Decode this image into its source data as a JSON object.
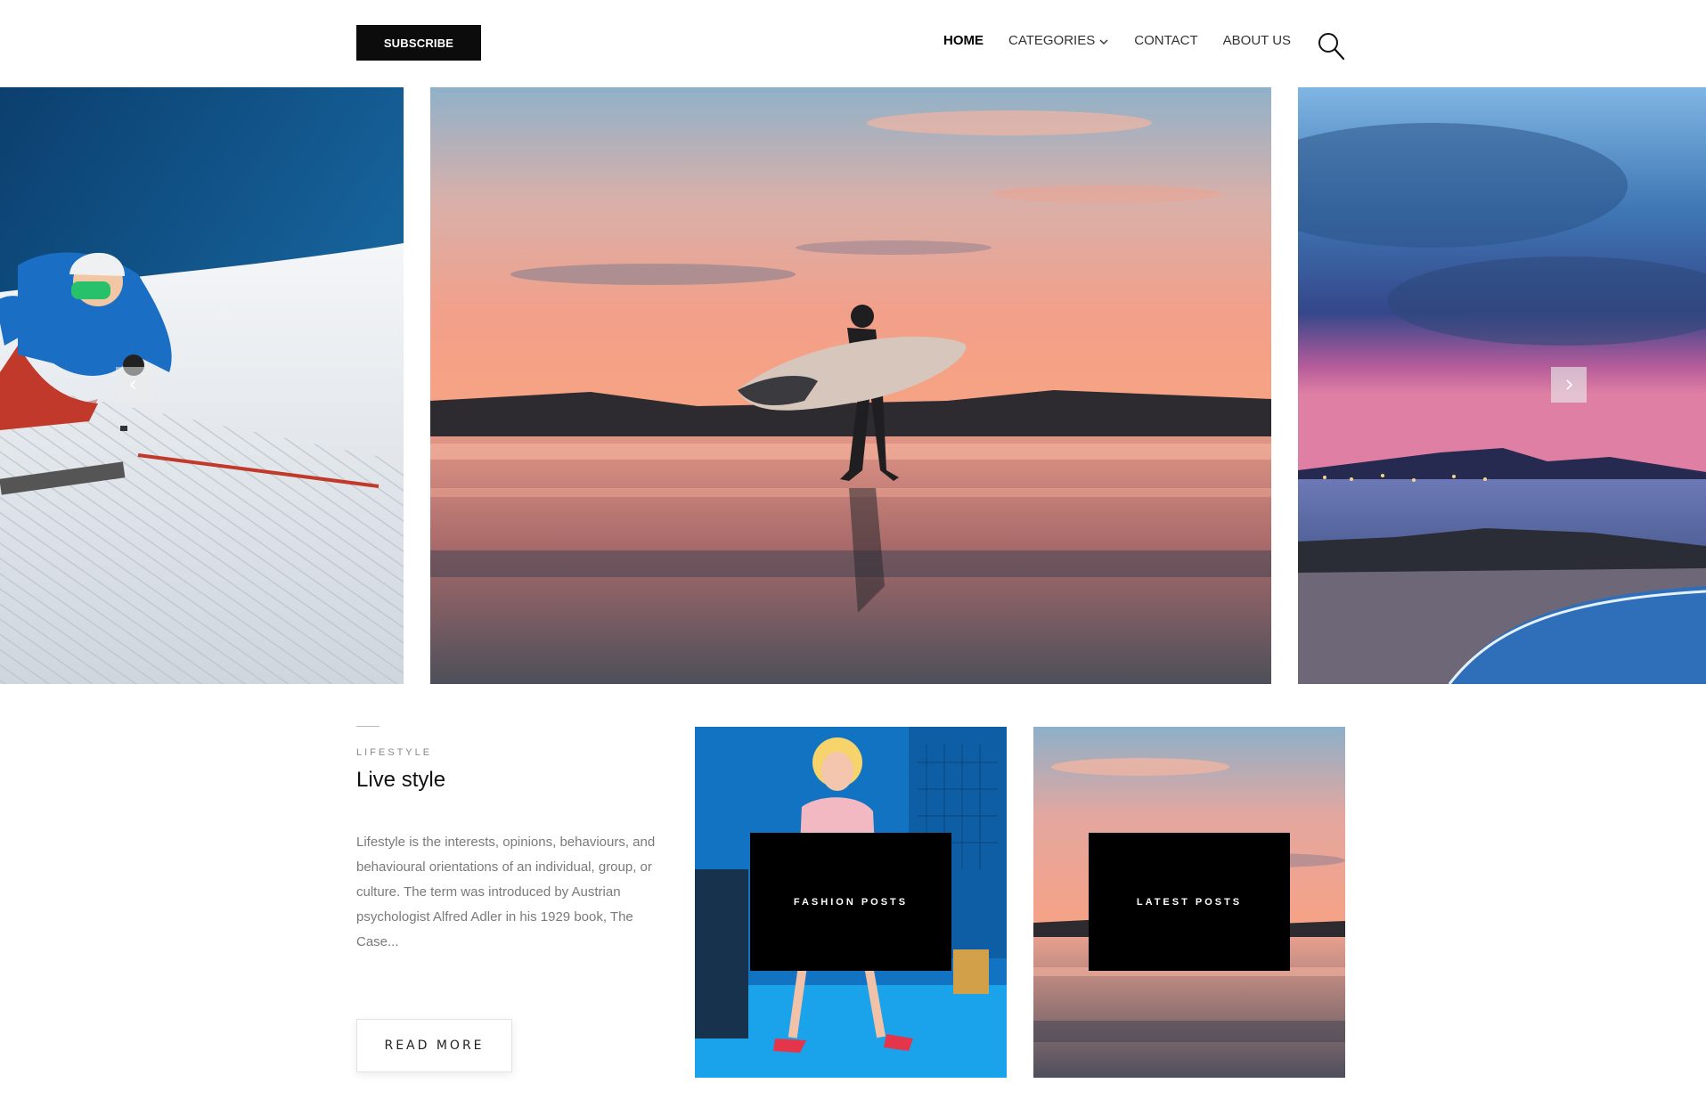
{
  "header": {
    "subscribe_label": "SUBSCRIBE",
    "nav": {
      "home": "HOME",
      "categories": "CATEGORIES",
      "contact": "CONTACT",
      "about": "ABOUT US"
    },
    "search_icon": "search-icon"
  },
  "slider": {
    "slides": [
      {
        "image": "skier-on-snow-slope"
      },
      {
        "image": "surfer-walking-at-sunset"
      },
      {
        "image": "rocky-coast-at-dusk"
      }
    ],
    "prev_icon": "chevron-left-icon",
    "next_icon": "chevron-right-icon"
  },
  "post": {
    "category": "LIFESTYLE",
    "title": "Live style",
    "excerpt": "Lifestyle is the interests, opinions, behaviours, and behavioural orientations of an individual, group, or culture. The term was introduced by Austrian psychologist Alfred Adler in his 1929 book, The Case...",
    "read_more_label": "READ MORE"
  },
  "cards": {
    "fashion": {
      "label": "FASHION POSTS"
    },
    "latest": {
      "label": "LATEST POSTS"
    }
  },
  "colors": {
    "black": "#0c0c0c",
    "text_gray": "#7a7a7a",
    "sunset_pink": "#f0a08e",
    "sky_blue": "#4f93cf"
  }
}
